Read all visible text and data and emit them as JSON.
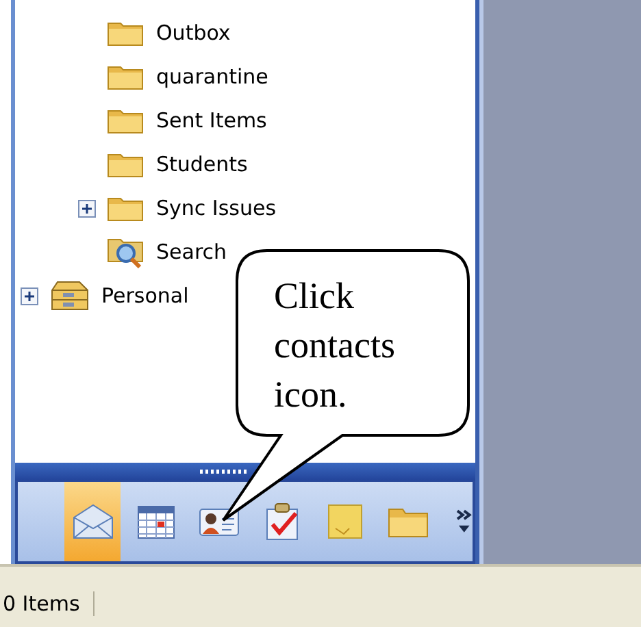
{
  "mailbox_folders": [
    {
      "label": "Outbox",
      "kind": "folder",
      "expandable": false
    },
    {
      "label": "quarantine",
      "kind": "folder",
      "expandable": false
    },
    {
      "label": "Sent Items",
      "kind": "folder",
      "expandable": false
    },
    {
      "label": "Students",
      "kind": "folder",
      "expandable": false
    },
    {
      "label": "Sync Issues",
      "kind": "folder",
      "expandable": true,
      "expanded": false
    },
    {
      "label": "Search",
      "kind": "search",
      "expandable": false
    }
  ],
  "root_items": [
    {
      "label": "Personal",
      "kind": "personal",
      "expandable": true,
      "expanded": false
    }
  ],
  "nav_buttons": [
    {
      "kind": "mail",
      "selected": true
    },
    {
      "kind": "calendar",
      "selected": false
    },
    {
      "kind": "contacts",
      "selected": false
    },
    {
      "kind": "tasks",
      "selected": false
    },
    {
      "kind": "notes",
      "selected": false
    },
    {
      "kind": "folder",
      "selected": false
    }
  ],
  "callout": {
    "text": "Click contacts icon."
  },
  "status_bar": {
    "text": "0 Items"
  }
}
